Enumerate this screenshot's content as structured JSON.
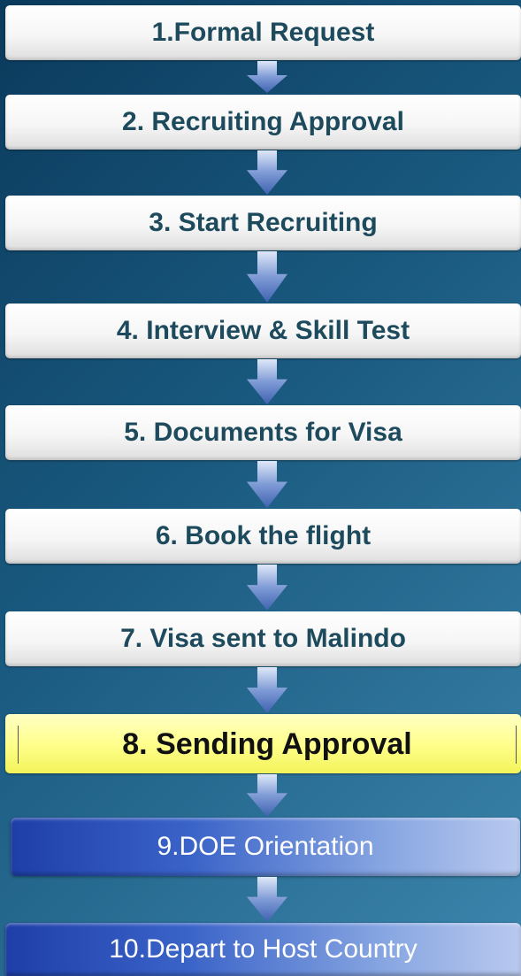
{
  "steps": [
    {
      "label": "1.Formal Request"
    },
    {
      "label": "2. Recruiting Approval"
    },
    {
      "label": "3. Start Recruiting"
    },
    {
      "label": "4. Interview & Skill Test"
    },
    {
      "label": "5. Documents for Visa"
    },
    {
      "label": "6. Book the flight"
    },
    {
      "label": "7. Visa sent to Malindo"
    },
    {
      "label": "8. Sending Approval"
    },
    {
      "label": "9.DOE Orientation"
    },
    {
      "label": "10.Depart to Host Country"
    }
  ],
  "colors": {
    "background": "#1a5a80",
    "step_box": "#ffffff",
    "highlight_box": "#ffff8e",
    "final_box": "#3a63c8",
    "arrow": "#5e7fc0"
  },
  "icons": {
    "connector": "down-arrow-icon"
  }
}
